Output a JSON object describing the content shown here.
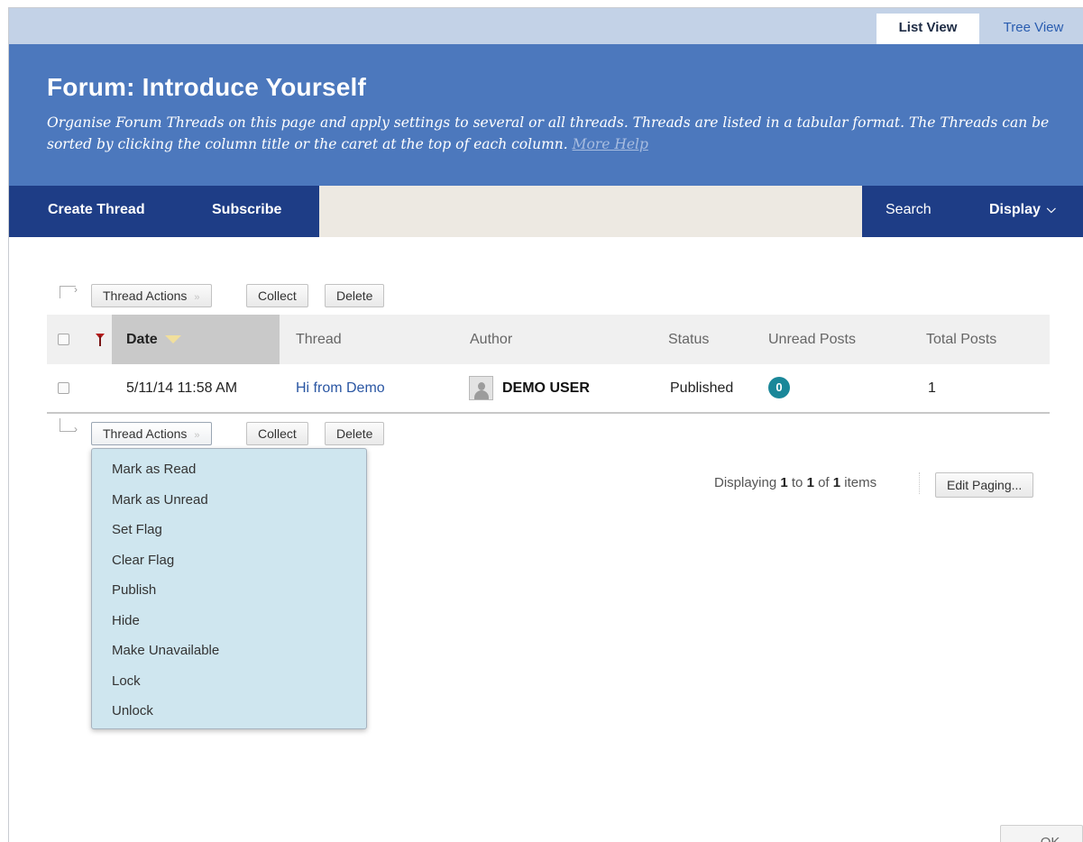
{
  "view_tabs": {
    "list": "List View",
    "tree": "Tree View"
  },
  "header": {
    "title": "Forum: Introduce Yourself",
    "instructions": "Organise Forum Threads on this page and apply settings to several or all threads. Threads are listed in a tabular format. The Threads can be sorted by clicking the column title or the caret at the top of each column.",
    "more_help": "More Help"
  },
  "action_bar": {
    "create_thread": "Create Thread",
    "subscribe": "Subscribe",
    "search": "Search",
    "display": "Display",
    "display_icon": "chevron-down-icon"
  },
  "toolbar": {
    "thread_actions": "Thread Actions",
    "thread_actions_icon": "double-chevron-down-icon",
    "collect": "Collect",
    "delete": "Delete"
  },
  "table": {
    "columns": {
      "date": "Date",
      "thread": "Thread",
      "author": "Author",
      "status": "Status",
      "unread_posts": "Unread Posts",
      "total_posts": "Total Posts"
    },
    "rows": [
      {
        "date": "5/11/14 11:58 AM",
        "thread": "Hi from Demo",
        "author": "DEMO USER",
        "status": "Published",
        "unread_posts": "0",
        "total_posts": "1"
      }
    ]
  },
  "thread_actions_menu": [
    "Mark as Read",
    "Mark as Unread",
    "Set Flag",
    "Clear Flag",
    "Publish",
    "Hide",
    "Make Unavailable",
    "Lock",
    "Unlock"
  ],
  "paging": {
    "prefix": "Displaying",
    "from": "1",
    "to_word": "to",
    "to": "1",
    "of_word": "of",
    "total": "1",
    "suffix": "items",
    "edit_paging": "Edit Paging..."
  },
  "ok_button": "OK",
  "colors": {
    "header_blue": "#4c78bd",
    "action_bar_navy": "#1e3d86",
    "tab_strip": "#c3d2e7",
    "menu_bg": "#cfe6ef",
    "badge_teal": "#1a8799",
    "sort_caret": "#f1df9c"
  }
}
